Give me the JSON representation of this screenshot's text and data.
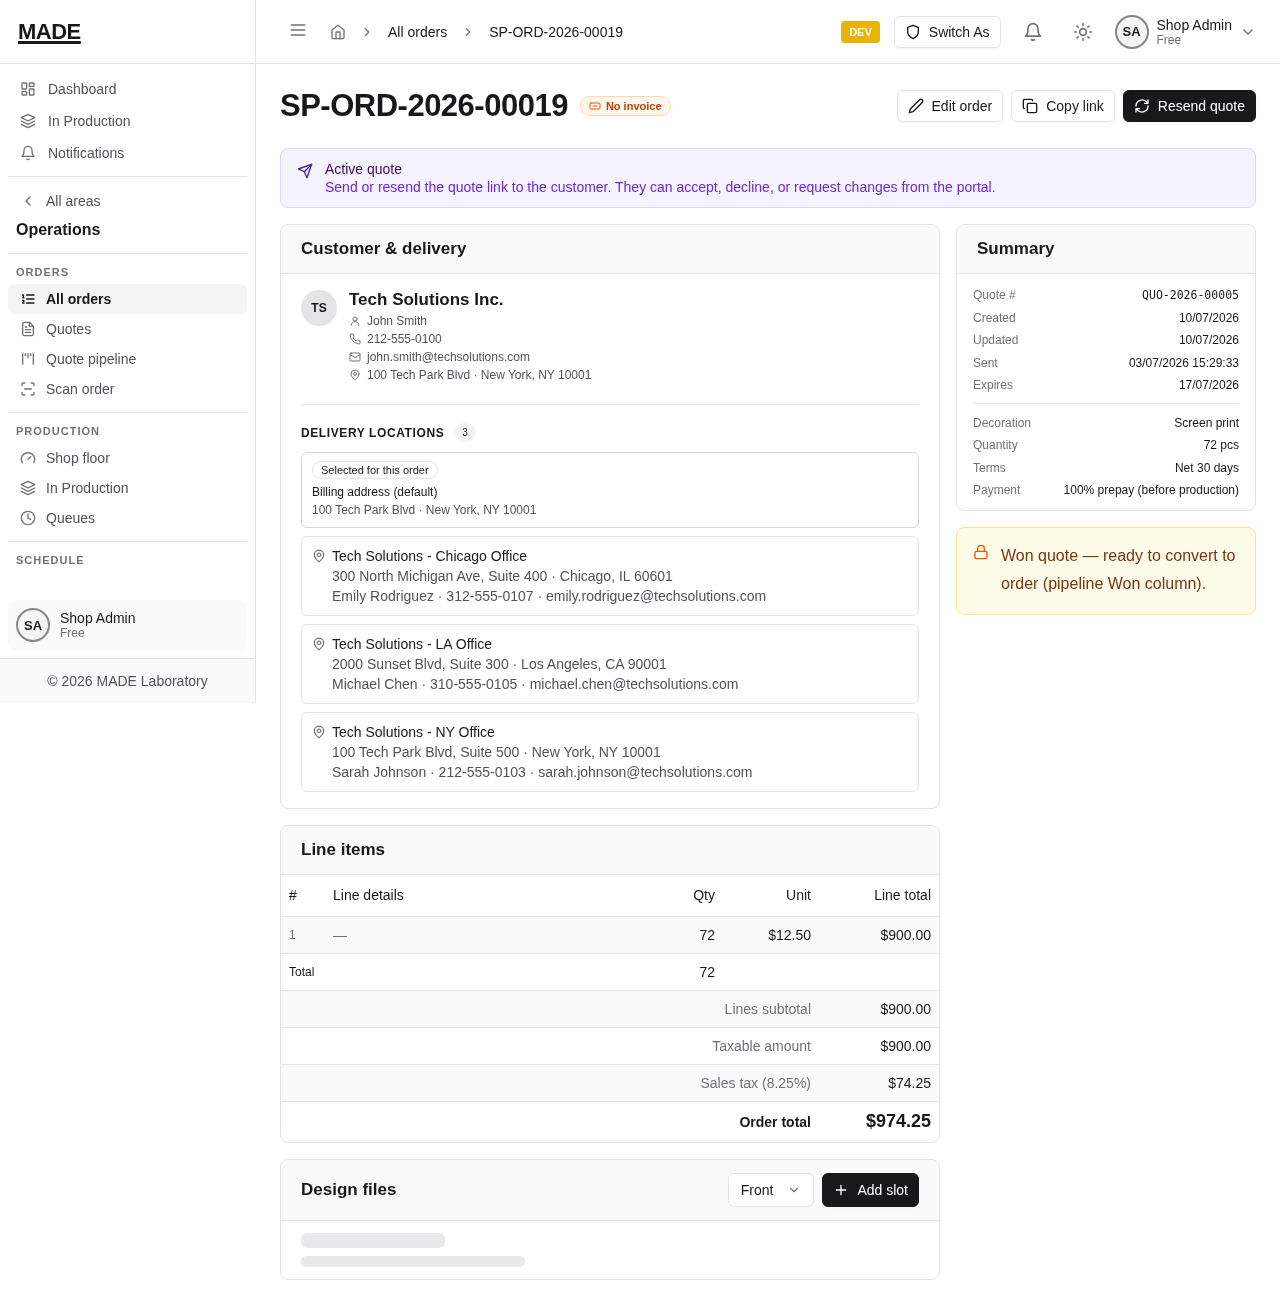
{
  "sidebar": {
    "logo": "MADE",
    "top_nav": [
      {
        "label": "Dashboard",
        "kind": "grid"
      },
      {
        "label": "In Production",
        "kind": "layers"
      },
      {
        "label": "Notifications",
        "kind": "bell"
      }
    ],
    "back_link": "All areas",
    "area_title": "Operations",
    "sections": [
      {
        "title": "ORDERS",
        "items": [
          {
            "label": "All orders",
            "kind": "list",
            "selected": true
          },
          {
            "label": "Quotes",
            "kind": "file",
            "selected": false
          },
          {
            "label": "Quote pipeline",
            "kind": "pipeline",
            "selected": false
          },
          {
            "label": "Scan order",
            "kind": "scan",
            "selected": false
          }
        ]
      },
      {
        "title": "PRODUCTION",
        "items": [
          {
            "label": "Shop floor",
            "kind": "gauge",
            "selected": false
          },
          {
            "label": "In Production",
            "kind": "layers",
            "selected": false
          },
          {
            "label": "Queues",
            "kind": "clock",
            "selected": false
          }
        ]
      },
      {
        "title": "SCHEDULE"
      }
    ],
    "user": {
      "initials": "SA",
      "name": "Shop Admin",
      "plan": "Free"
    },
    "footer": "© 2026 MADE Laboratory"
  },
  "header": {
    "breadcrumbs": [
      "All orders",
      "SP-ORD-2026-00019"
    ],
    "env_badge": "DEV",
    "switch_button": "Switch As",
    "user": {
      "initials": "SA",
      "name": "Shop Admin",
      "plan": "Free"
    }
  },
  "page": {
    "title": "SP-ORD-2026-00019",
    "badge": "No invoice",
    "actions": [
      {
        "label": "Edit order",
        "kind": "secondary"
      },
      {
        "label": "Copy link",
        "kind": "secondary"
      },
      {
        "label": "Resend quote",
        "kind": "primary"
      }
    ]
  },
  "banner": {
    "title": "Active quote",
    "text": "Send or resend the quote link to the customer. They can accept, decline, or request changes from the portal."
  },
  "customer": {
    "title": "Customer & delivery",
    "initials": "TS",
    "company": "Tech Solutions Inc.",
    "contacts": [
      {
        "kind": "user",
        "text": "John Smith"
      },
      {
        "kind": "phone",
        "text": "212-555-0100"
      },
      {
        "kind": "mail",
        "text": "john.smith@techsolutions.com"
      },
      {
        "kind": "pin",
        "text": "100 Tech Park Blvd · New York, NY 10001"
      }
    ],
    "delivery_title": "DELIVERY LOCATIONS",
    "delivery_count": "3",
    "locations": [
      {
        "selected": true,
        "tag": "Selected for this order",
        "name": "Billing address (default)",
        "address": "100 Tech Park Blvd · New York, NY 10001"
      },
      {
        "selected": false,
        "name": "Tech Solutions - Chicago Office",
        "address": "300 North Michigan Ave, Suite 400 · Chicago, IL 60601",
        "contact": "Emily Rodriguez · 312-555-0107 · emily.rodriguez@techsolutions.com"
      },
      {
        "selected": false,
        "name": "Tech Solutions - LA Office",
        "address": "2000 Sunset Blvd, Suite 300 · Los Angeles, CA 90001",
        "contact": "Michael Chen · 310-555-0105 · michael.chen@techsolutions.com"
      },
      {
        "selected": false,
        "name": "Tech Solutions - NY Office",
        "address": "100 Tech Park Blvd, Suite 500 · New York, NY 10001",
        "contact": "Sarah Johnson · 212-555-0103 · sarah.johnson@techsolutions.com"
      }
    ]
  },
  "line_items": {
    "title": "Line items",
    "columns": [
      "#",
      "Line details",
      "Qty",
      "Unit",
      "Line total"
    ],
    "rows": [
      {
        "index": "1",
        "details": "—",
        "qty": "72",
        "unit": "$12.50",
        "total": "$900.00"
      }
    ],
    "total_row": {
      "label": "Total",
      "qty": "72"
    },
    "summary": [
      {
        "label": "Lines subtotal",
        "value": "$900.00",
        "kind": "normal"
      },
      {
        "label": "Taxable amount",
        "value": "$900.00",
        "kind": "normal"
      },
      {
        "label": "Sales tax (8.25%)",
        "value": "$74.25",
        "kind": "normal"
      },
      {
        "label": "Order total",
        "value": "$974.25",
        "kind": "grand"
      }
    ]
  },
  "design_files": {
    "title": "Design files",
    "select": "Front",
    "button": "Add slot"
  },
  "summary": {
    "title": "Summary",
    "groups": [
      [
        {
          "label": "Quote #",
          "value": "QUO-2026-00005",
          "kind": "code"
        },
        {
          "label": "Created",
          "value": "10/07/2026",
          "kind": "text"
        },
        {
          "label": "Updated",
          "value": "10/07/2026",
          "kind": "text"
        },
        {
          "label": "Sent",
          "value": "03/07/2026 15:29:33",
          "kind": "text"
        },
        {
          "label": "Expires",
          "value": "17/07/2026",
          "kind": "text"
        }
      ],
      [
        {
          "label": "Decoration",
          "value": "Screen print",
          "kind": "text"
        },
        {
          "label": "Quantity",
          "value": "72 pcs",
          "kind": "text"
        },
        {
          "label": "Terms",
          "value": "Net 30 days",
          "kind": "text"
        },
        {
          "label": "Payment",
          "value": "100% prepay (before production)",
          "kind": "text"
        }
      ]
    ]
  },
  "notice": {
    "text": "Won quote — ready to convert to order (pipeline Won column)."
  }
}
